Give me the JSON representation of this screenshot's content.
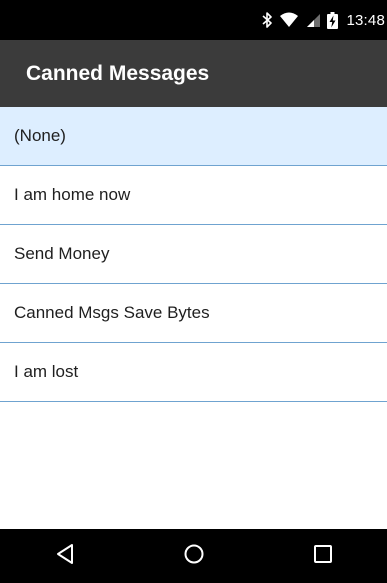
{
  "status_bar": {
    "time": "13:48",
    "icons": [
      "bluetooth-icon",
      "wifi-icon",
      "cell-signal-icon",
      "battery-charging-icon"
    ],
    "text_color": "#ffffff",
    "background": "#000000"
  },
  "app_bar": {
    "title": "Canned Messages",
    "background": "#3b3b3b"
  },
  "messages": {
    "selected_background": "#ddeeff",
    "divider_color": "#6fa3d0",
    "items": [
      {
        "label": "(None)",
        "selected": true
      },
      {
        "label": "I am home now",
        "selected": false
      },
      {
        "label": "Send Money",
        "selected": false
      },
      {
        "label": "Canned Msgs Save Bytes",
        "selected": false
      },
      {
        "label": "I am lost",
        "selected": false
      }
    ]
  },
  "nav_bar": {
    "buttons": [
      "back-icon",
      "home-icon",
      "recents-icon"
    ],
    "background": "#000000"
  }
}
